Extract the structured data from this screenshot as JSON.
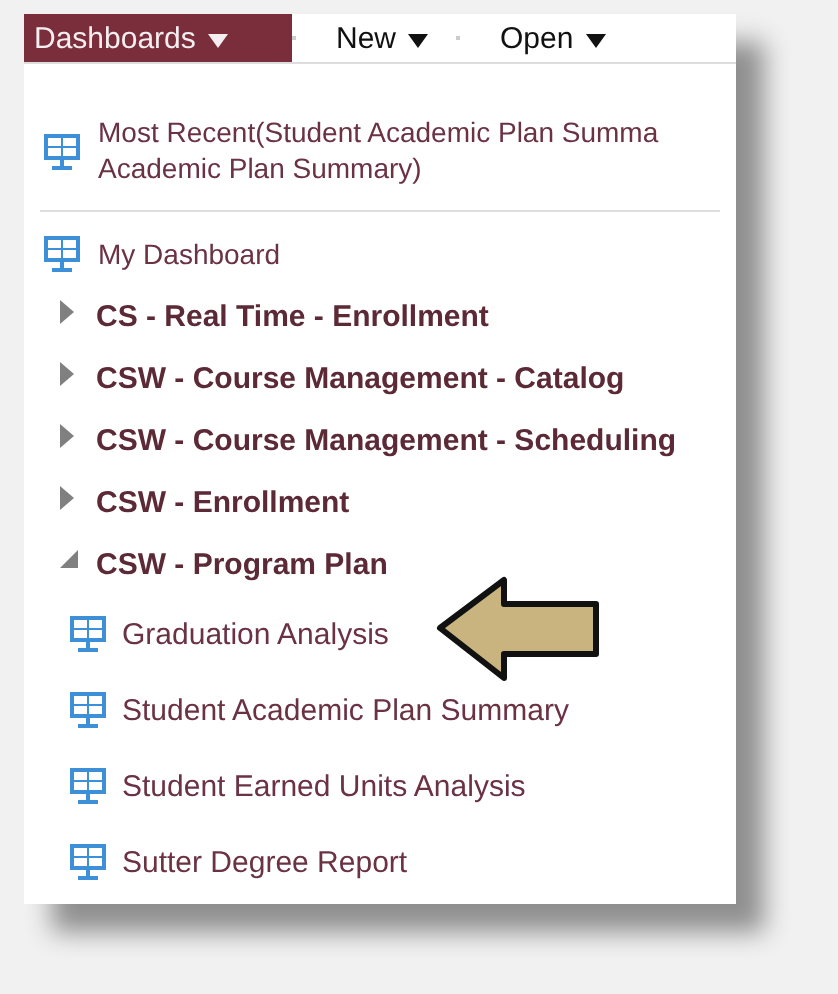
{
  "menu_bar": [
    {
      "label": "Dashboards",
      "selected": true
    },
    {
      "label": "New",
      "selected": false
    },
    {
      "label": "Open",
      "selected": false
    }
  ],
  "most_recent": {
    "lines": [
      "Most Recent(Student Academic Plan Summa",
      "Academic Plan Summary)"
    ]
  },
  "my_dashboard": {
    "label": "My Dashboard"
  },
  "folders": [
    {
      "label": "CS - Real Time - Enrollment",
      "expanded": false
    },
    {
      "label": "CSW - Course Management - Catalog",
      "expanded": false
    },
    {
      "label": "CSW - Course Management - Scheduling",
      "expanded": false
    },
    {
      "label": "CSW - Enrollment",
      "expanded": false
    },
    {
      "label": "CSW - Program Plan",
      "expanded": true,
      "children": [
        {
          "label": "Graduation Analysis"
        },
        {
          "label": "Student Academic Plan Summary"
        },
        {
          "label": "Student Earned Units Analysis"
        },
        {
          "label": "Sutter Degree Report"
        }
      ]
    }
  ]
}
